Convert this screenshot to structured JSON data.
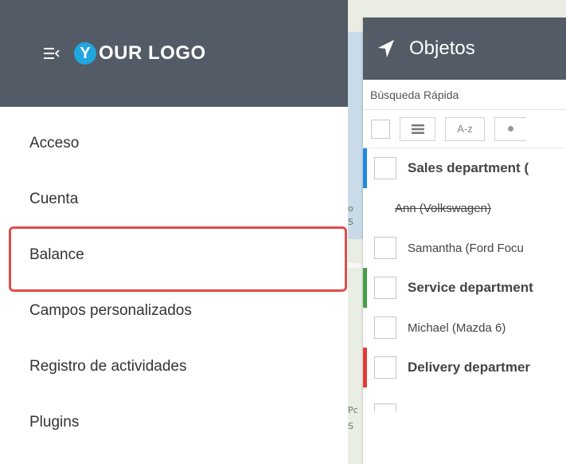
{
  "app": {
    "menu_icon": "hamburger-collapse-icon",
    "logo_letter": "Y",
    "logo_text": "OUR LOGO"
  },
  "nav": {
    "items": [
      {
        "label": "Acceso"
      },
      {
        "label": "Cuenta"
      },
      {
        "label": "Balance"
      },
      {
        "label": "Campos personalizados"
      },
      {
        "label": "Registro de actividades"
      },
      {
        "label": "Plugins"
      }
    ],
    "selected": "Balance"
  },
  "objects": {
    "title": "Objetos",
    "title_icon": "navigation-arrow-icon",
    "search_placeholder": "Búsqueda Rápida",
    "toolbar": {
      "list_icon": "list-icon",
      "sort_label": "A-z",
      "status_icon": "dot-icon"
    },
    "rows": [
      {
        "type": "group",
        "name": "Sales department (",
        "color": "#1e88e5"
      },
      {
        "type": "item",
        "name": "Ann (Volkswagen)",
        "strikethrough": true
      },
      {
        "type": "item",
        "name": "Samantha (Ford Focu"
      },
      {
        "type": "group",
        "name": "Service department",
        "color": "#43a047"
      },
      {
        "type": "item",
        "name": "Michael (Mazda 6)"
      },
      {
        "type": "group",
        "name": "Delivery departmer",
        "color": "#e53935"
      }
    ]
  },
  "map": {
    "labels": [
      "o",
      "S",
      "S",
      "Pc"
    ]
  },
  "colors": {
    "header_bg": "#535c66",
    "logo_accent": "#22a6e0",
    "highlight": "#e34c4c"
  }
}
